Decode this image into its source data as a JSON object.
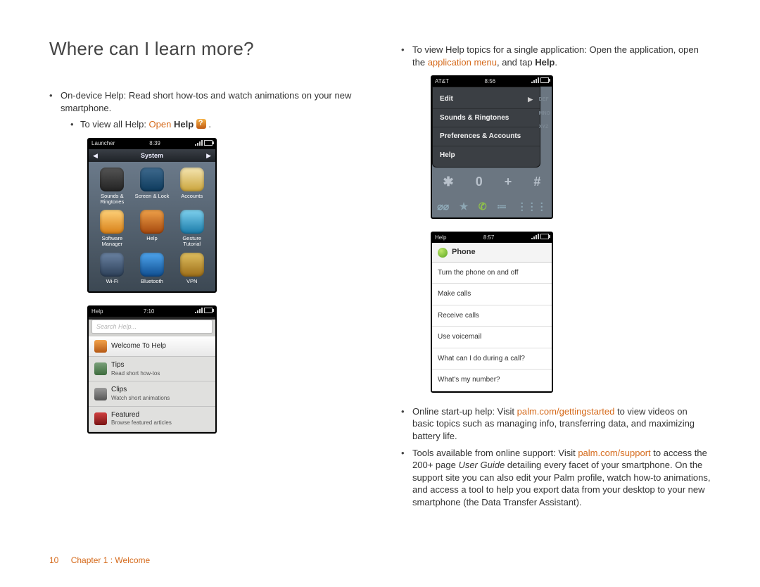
{
  "heading": "Where can I learn more?",
  "left": {
    "intro": "On-device Help: Read short how-tos and watch animations on your new smartphone.",
    "viewAll": {
      "prefix": "To view all Help: ",
      "link": "Open ",
      "bold": "Help"
    },
    "device1": {
      "carrier": "Launcher",
      "time": "8:39",
      "section": "System",
      "apps": [
        {
          "label": "Sounds & Ringtones",
          "color": "linear-gradient(#555,#222)"
        },
        {
          "label": "Screen & Lock",
          "color": "linear-gradient(#3f6a8e,#0d3a5c)"
        },
        {
          "label": "Accounts",
          "color": "linear-gradient(#f5e6b2,#caa33a)"
        },
        {
          "label": "Software Manager",
          "color": "linear-gradient(#ffd27a,#d77f17)"
        },
        {
          "label": "Help",
          "color": "linear-gradient(#f0a24a,#a4470d)"
        },
        {
          "label": "Gesture Tutorial",
          "color": "linear-gradient(#7fd2f0,#1a7aa8)"
        },
        {
          "label": "Wi-Fi",
          "color": "linear-gradient(#6b83a3,#2c3f57)"
        },
        {
          "label": "Bluetooth",
          "color": "linear-gradient(#4fa6ef,#0f4d8f)"
        },
        {
          "label": "VPN",
          "color": "linear-gradient(#e0c060,#9c6d18)"
        }
      ]
    },
    "device2": {
      "carrier": "Help",
      "time": "7:10",
      "searchPlaceholder": "Search Help...",
      "rows": [
        {
          "title": "Welcome To Help",
          "sub": "",
          "icon": "linear-gradient(#f2a24a,#b55914)",
          "hl": true
        },
        {
          "title": "Tips",
          "sub": "Read short how-tos",
          "icon": "linear-gradient(#7aa07a,#3d6c3d)"
        },
        {
          "title": "Clips",
          "sub": "Watch short animations",
          "icon": "linear-gradient(#9a9a9a,#555)"
        },
        {
          "title": "Featured",
          "sub": "Browse featured articles",
          "icon": "linear-gradient(#d04040,#7a1414)"
        }
      ]
    }
  },
  "right": {
    "topBullet": {
      "t1": "To view Help topics for a single application: Open the application, open the ",
      "link": "application menu",
      "t2": ", and tap ",
      "bold": "Help",
      "t3": "."
    },
    "device3": {
      "carrier": "AT&T",
      "time": "8:56",
      "menu": [
        "Edit",
        "Sounds & Ringtones",
        "Preferences & Accounts",
        "Help"
      ],
      "sidekeys": [
        "DEF",
        "MNO",
        "XYZ"
      ],
      "keyrow": [
        "✱",
        "0",
        "+",
        "#"
      ]
    },
    "device4": {
      "carrier": "Help",
      "time": "8:57",
      "header": "Phone",
      "topics": [
        "Turn the phone on and off",
        "Make calls",
        "Receive calls",
        "Use voicemail",
        "What can I do during a call?",
        "What's my number?"
      ]
    },
    "bullets": [
      {
        "t1": "Online start-up help: Visit ",
        "link": "palm.com/gettingstarted",
        "t2": " to view videos on basic topics such as managing info, transferring data, and maximizing battery life."
      },
      {
        "t1": "Tools available from online support: Visit ",
        "link": "palm.com/support",
        "t2": " to access the 200+ page ",
        "italic": "User Guide",
        "t3": " detailing every facet of your smartphone. On the support site you can also edit your Palm profile, watch how-to animations, and access a tool to help you export data from your desktop to your new smartphone (the Data Transfer Assistant)."
      }
    ]
  },
  "footer": {
    "page": "10",
    "chapter": "Chapter 1 : Welcome"
  }
}
